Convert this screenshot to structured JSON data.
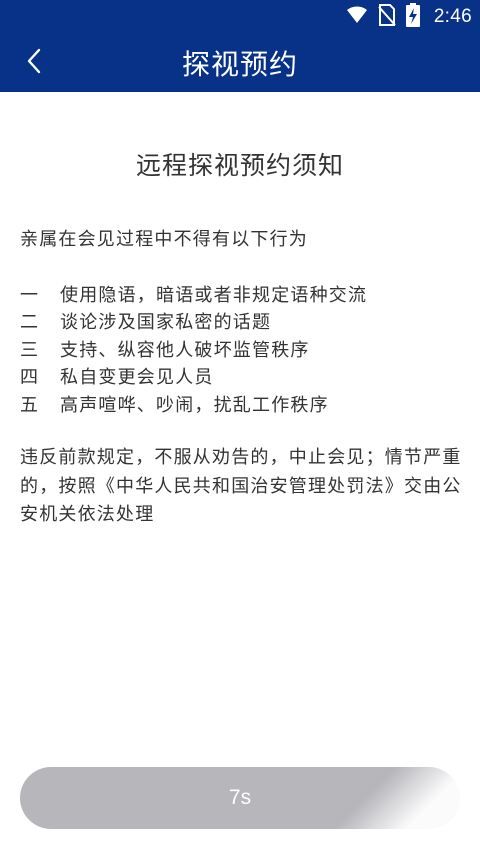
{
  "status_bar": {
    "time": "2:46",
    "icons": [
      "wifi-icon",
      "no-sim-icon",
      "battery-charging-icon"
    ]
  },
  "app_bar": {
    "title": "探视预约",
    "back_icon": "chevron-left-icon"
  },
  "notice": {
    "title": "远程探视预约须知",
    "intro": "亲属在会见过程中不得有以下行为",
    "rules": [
      {
        "num": "一",
        "text": "使用隐语，暗语或者非规定语种交流"
      },
      {
        "num": "二",
        "text": "谈论涉及国家私密的话题"
      },
      {
        "num": "三",
        "text": "支持、纵容他人破坏监管秩序"
      },
      {
        "num": "四",
        "text": "私自变更会见人员"
      },
      {
        "num": "五",
        "text": "高声喧哗、吵闹，扰乱工作秩序"
      }
    ],
    "warning": "违反前款规定，不服从劝告的，中止会见；情节严重的，按照《中华人民共和国治安管理处罚法》交由公安机关依法处理"
  },
  "countdown_button": {
    "label": "7s"
  },
  "colors": {
    "header_bg": "#073287",
    "button_disabled": "#b6b6bb",
    "text": "#333333"
  }
}
